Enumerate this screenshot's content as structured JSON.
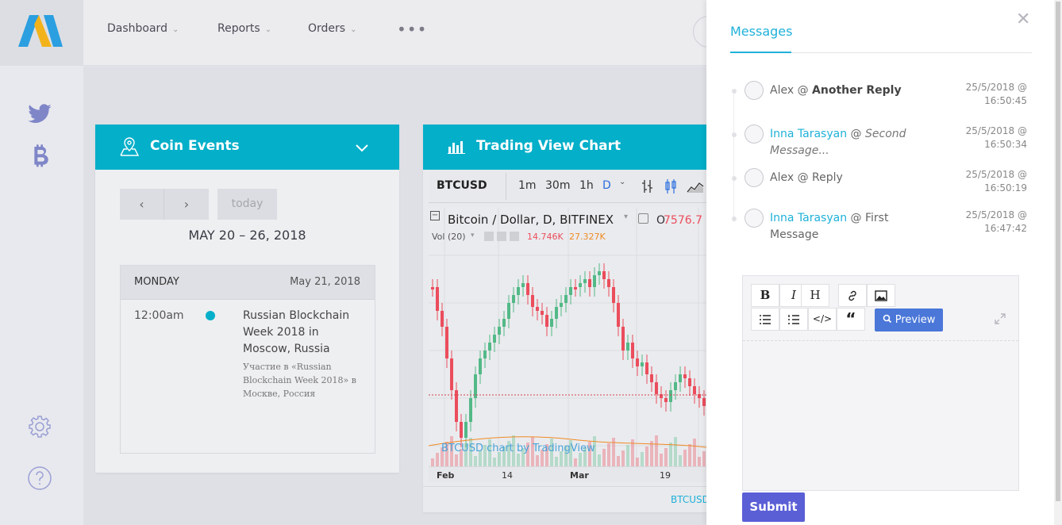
{
  "nav": {
    "items": [
      {
        "label": "Dashboard"
      },
      {
        "label": "Reports"
      },
      {
        "label": "Orders"
      }
    ]
  },
  "coin_events": {
    "title": "Coin Events",
    "today_label": "today",
    "range": "MAY 20 – 26, 2018",
    "day_name": "MONDAY",
    "day_date": "May 21, 2018",
    "event_time": "12:00am",
    "event_title": "Russian Blockchain Week 2018 in Moscow, Russia",
    "event_desc": "Участие в «Russian Blockchain Week 2018» в Москве, Россия"
  },
  "trading": {
    "title": "Trading View Chart",
    "symbol": "BTCUSD",
    "intervals": [
      "1m",
      "30m",
      "1h",
      "D"
    ],
    "chart_title": "Bitcoin / Dollar, D, BITFINEX",
    "price_prefix": "O",
    "price": "7576.7",
    "vol_label": "Vol (20)",
    "vol_value1": "14.746K",
    "vol_value2": "27.327K",
    "watermark": "BTCUSD chart by TradingView",
    "x_ticks": [
      "Feb",
      "14",
      "Mar",
      "19"
    ],
    "footer_symbol": "BTCUSD"
  },
  "messages": {
    "tab_label": "Messages",
    "items": [
      {
        "author": "Alex",
        "at": "@",
        "body": "Another Reply",
        "time1": "25/5/2018 @",
        "time2": "16:50:45"
      },
      {
        "author": "Inna Tarasyan",
        "at": "@",
        "body": "Second Message...",
        "time1": "25/5/2018 @",
        "time2": "16:50:34"
      },
      {
        "author": "Alex",
        "at": "@",
        "body": "Reply",
        "time1": "25/5/2018 @",
        "time2": "16:50:19"
      },
      {
        "author": "Inna Tarasyan",
        "at": "@",
        "body": "First Message",
        "time1": "25/5/2018 @",
        "time2": "16:47:42"
      }
    ]
  },
  "editor": {
    "bold_label": "B",
    "italic_label": "I",
    "heading_label": "H",
    "preview_label": "Preview",
    "submit_label": "Submit"
  },
  "colors": {
    "accent": "#03afc9",
    "link": "#1fb1d9",
    "submit": "#5a5fd6",
    "preview": "#4a77d8",
    "candle_up": "#53b987",
    "candle_down": "#eb4d5c"
  }
}
